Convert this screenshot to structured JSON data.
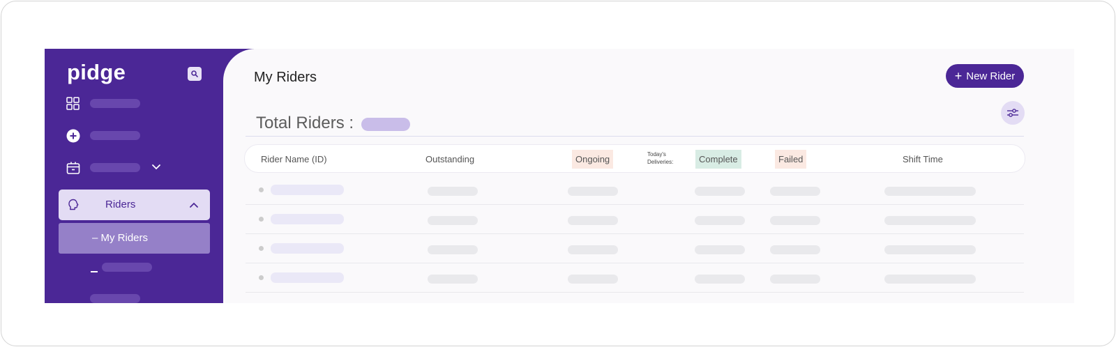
{
  "app": {
    "logo_text": "pidge"
  },
  "sidebar": {
    "riders_label": "Riders",
    "my_riders_label": "– My Riders"
  },
  "header": {
    "title": "My Riders",
    "new_rider_label": "New Rider",
    "total_label": "Total Riders :"
  },
  "table": {
    "columns": {
      "rider_name": "Rider Name (ID)",
      "outstanding": "Outstanding",
      "ongoing": "Ongoing",
      "todays_deliveries": "Today's Deliveries:",
      "complete": "Complete",
      "failed": "Failed",
      "shift_time": "Shift Time"
    },
    "row_count": 4
  },
  "colors": {
    "brand": "#4b2796",
    "active_item": "#e3dcf4",
    "selected_subitem": "#9580c8",
    "ongoing_tag": "#fbe9e2",
    "complete_tag": "#d8ece4",
    "failed_tag": "#fbe9e2"
  },
  "icons": [
    "search-icon",
    "grid-icon",
    "plus-circle-icon",
    "box-icon",
    "chevron-down-icon",
    "rider-icon",
    "chevron-up-icon",
    "plus-icon",
    "filter-sliders-icon"
  ]
}
